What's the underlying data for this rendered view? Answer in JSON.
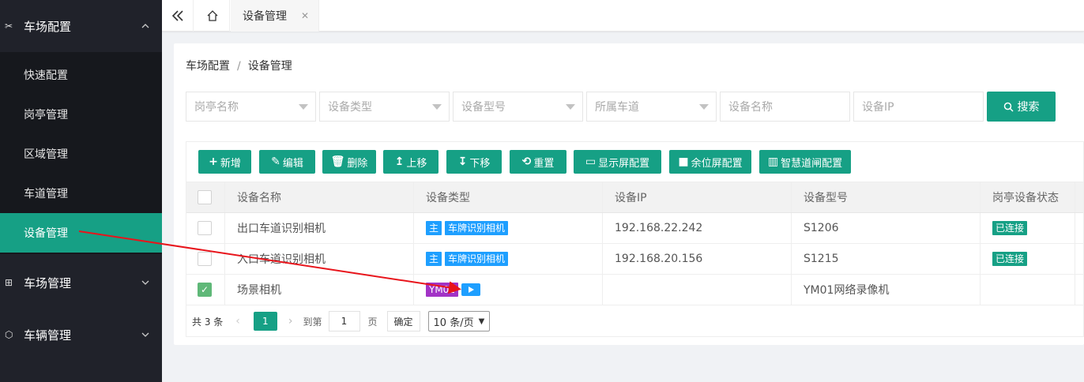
{
  "sidebar": {
    "groups": [
      {
        "label": "车场配置",
        "icon": "tools-icon",
        "expanded": true
      },
      {
        "label": "车场管理",
        "icon": "grid-icon",
        "expanded": false
      },
      {
        "label": "车辆管理",
        "icon": "cube-icon",
        "expanded": false
      }
    ],
    "items": [
      {
        "label": "快速配置"
      },
      {
        "label": "岗亭管理"
      },
      {
        "label": "区域管理"
      },
      {
        "label": "车道管理"
      },
      {
        "label": "设备管理",
        "active": true
      }
    ]
  },
  "topbar": {
    "tab_label": "设备管理"
  },
  "breadcrumb": {
    "parent": "车场配置",
    "separator": "/",
    "current": "设备管理"
  },
  "filters": {
    "booth_name": "岗亭名称",
    "device_type": "设备类型",
    "device_model": "设备型号",
    "lane": "所属车道",
    "device_name": "设备名称",
    "device_ip": "设备IP",
    "search_label": "搜索"
  },
  "toolbar": {
    "add": "新增",
    "edit": "编辑",
    "delete": "删除",
    "move_up": "上移",
    "move_down": "下移",
    "reset": "重置",
    "display_config": "显示屏配置",
    "remaining_config": "余位屏配置",
    "gate_config": "智慧道闸配置"
  },
  "table": {
    "columns": [
      "设备名称",
      "设备类型",
      "设备IP",
      "设备型号",
      "岗亭设备状态"
    ],
    "rows": [
      {
        "name": "出口车道识别相机",
        "tag1": "主",
        "tag2": "车牌识别相机",
        "ip": "192.168.22.242",
        "model": "S1206",
        "status": "已连接",
        "checked": false
      },
      {
        "name": "入口车道识别相机",
        "tag1": "主",
        "tag2": "车牌识别相机",
        "ip": "192.168.20.156",
        "model": "S1215",
        "status": "已连接",
        "checked": false
      },
      {
        "name": "场景相机",
        "tag1": "YM01",
        "tag2": "",
        "ip": "",
        "model": "YM01网络录像机",
        "status": "",
        "checked": true
      }
    ]
  },
  "pager": {
    "total_text": "共 3 条",
    "current_page": "1",
    "goto_label": "到第",
    "goto_value": "1",
    "page_unit": "页",
    "confirm": "确定",
    "page_size": "10 条/页"
  },
  "colors": {
    "accent": "#16a085",
    "sidebar_bg": "#20222a",
    "tag_blue": "#1e9fff",
    "tag_purple": "#a233c6",
    "arrow_red": "#e8141b"
  }
}
